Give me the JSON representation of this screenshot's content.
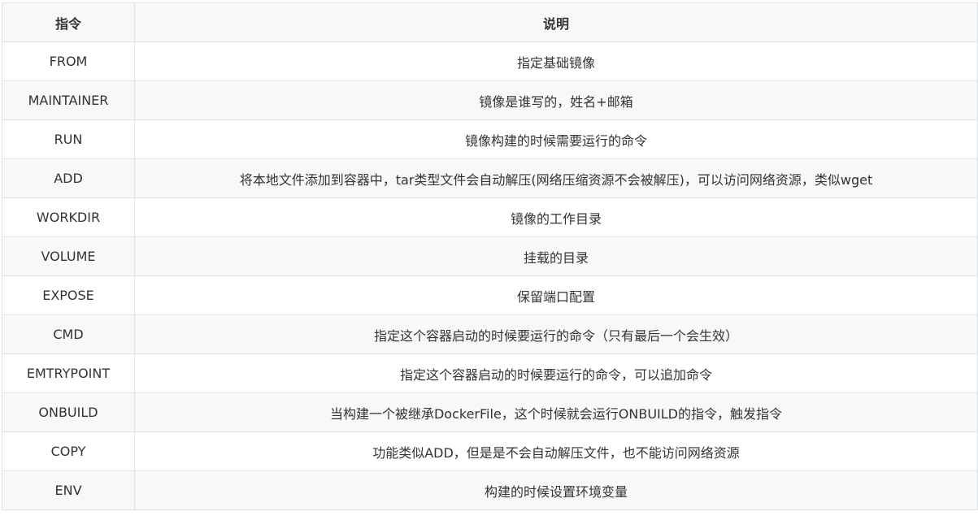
{
  "table": {
    "headers": [
      "指令",
      "说明"
    ],
    "rows": [
      [
        "FROM",
        "指定基础镜像"
      ],
      [
        "MAINTAINER",
        "镜像是谁写的，姓名+邮箱"
      ],
      [
        "RUN",
        "镜像构建的时候需要运行的命令"
      ],
      [
        "ADD",
        "将本地文件添加到容器中，tar类型文件会自动解压(网络压缩资源不会被解压)，可以访问网络资源，类似wget"
      ],
      [
        "WORKDIR",
        "镜像的工作目录"
      ],
      [
        "VOLUME",
        "挂载的目录"
      ],
      [
        "EXPOSE",
        "保留端口配置"
      ],
      [
        "CMD",
        "指定这个容器启动的时候要运行的命令（只有最后一个会生效）"
      ],
      [
        "EMTRYPOINT",
        "指定这个容器启动的时候要运行的命令，可以追加命令"
      ],
      [
        "ONBUILD",
        "当构建一个被继承DockerFile，这个时候就会运行ONBUILD的指令，触发指令"
      ],
      [
        "COPY",
        "功能类似ADD，但是是不会自动解压文件，也不能访问网络资源"
      ],
      [
        "ENV",
        "构建的时候设置环境变量"
      ]
    ]
  }
}
